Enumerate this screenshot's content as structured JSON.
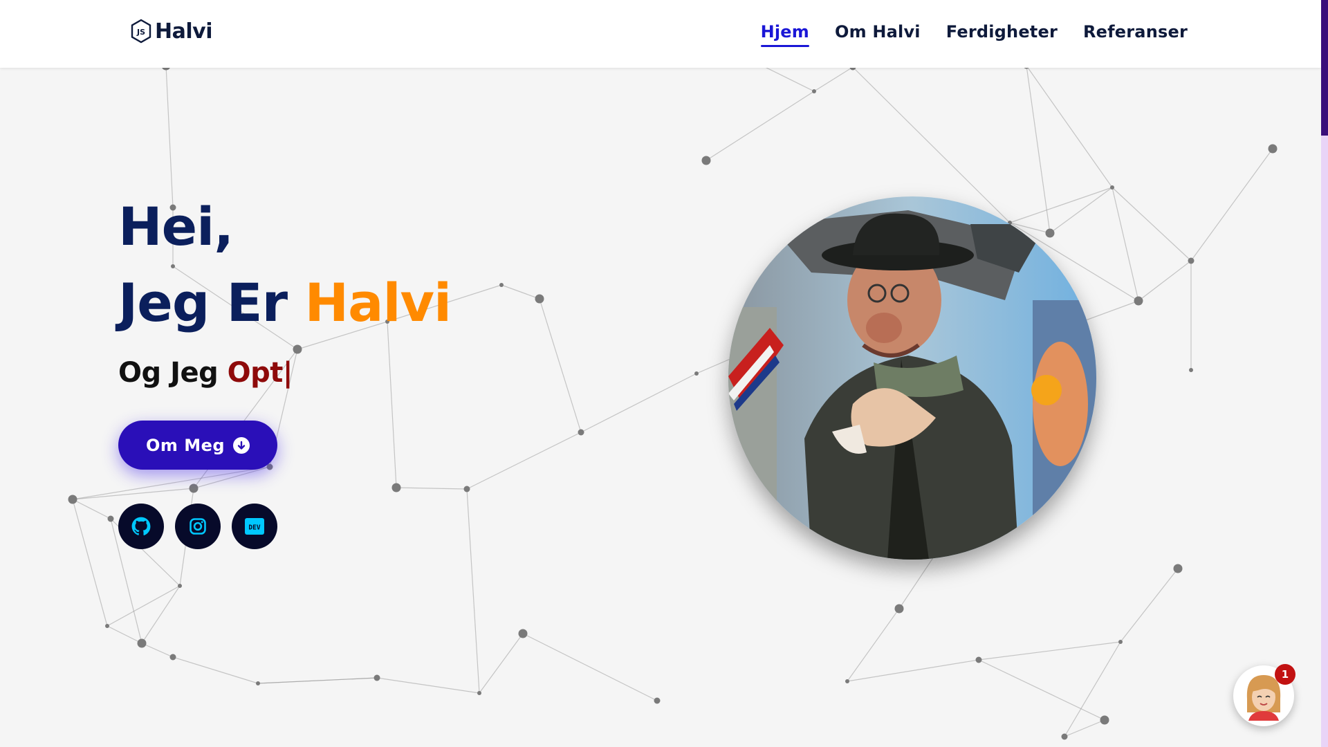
{
  "header": {
    "logo_text": "Halvi",
    "nav": [
      {
        "label": "Hjem",
        "active": true
      },
      {
        "label": "Om Halvi",
        "active": false
      },
      {
        "label": "Ferdigheter",
        "active": false
      },
      {
        "label": "Referanser",
        "active": false
      }
    ]
  },
  "hero": {
    "greeting": "Hei,",
    "intro": "Jeg Er ",
    "name": "Halvi",
    "sub_prefix": "Og Jeg ",
    "typed_text": "Opt",
    "caret": "|"
  },
  "cta": {
    "label": "Om Meg",
    "icon": "arrow-down-circle-icon"
  },
  "socials": [
    {
      "name": "github-icon"
    },
    {
      "name": "instagram-icon"
    },
    {
      "name": "dev-icon",
      "text": "DEV"
    }
  ],
  "chat": {
    "badge_count": "1",
    "icon": "avatar-icon"
  },
  "colors": {
    "accent": "#1a16d6",
    "name": "#ff8a00",
    "heading": "#0b1f5c",
    "typed": "#8e0a0a",
    "button": "#2a0fb8",
    "social_bg": "#070a2a",
    "social_icon": "#00c8ff"
  }
}
